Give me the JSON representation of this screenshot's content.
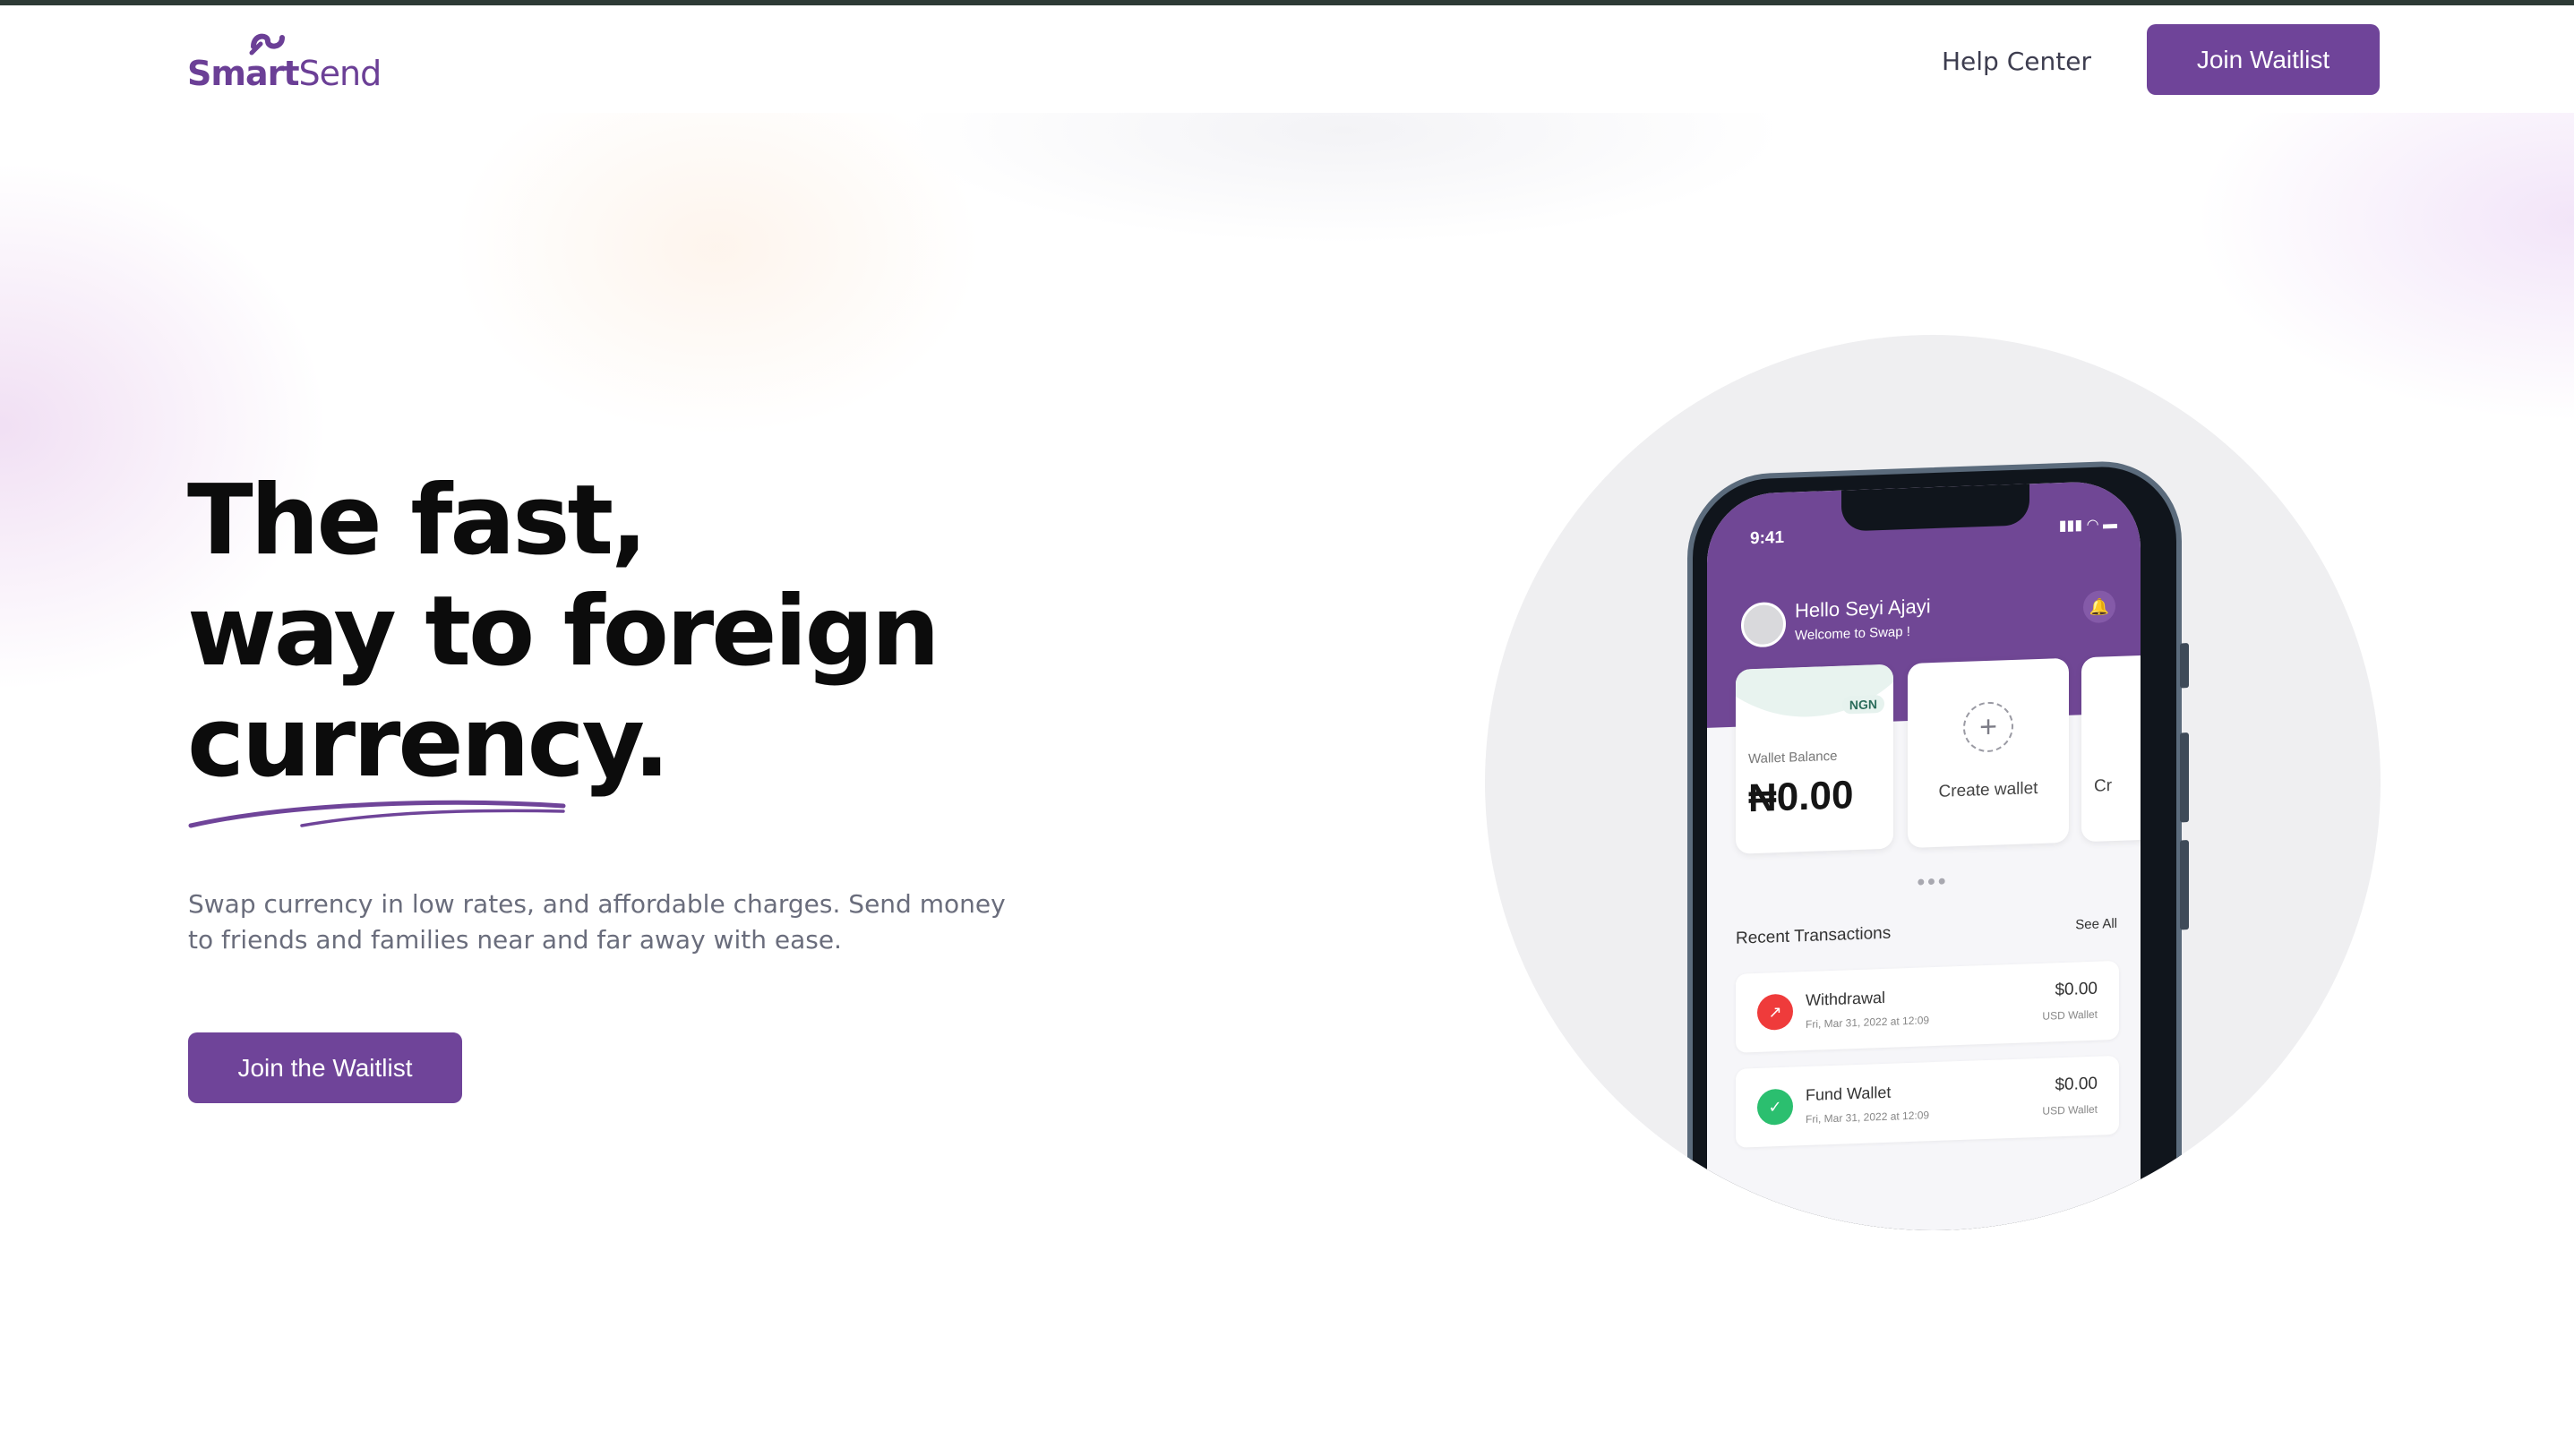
{
  "header": {
    "logo_text_bold": "Smart",
    "logo_text_light": "Send",
    "help_label": "Help Center",
    "cta_label": "Join Waitlist"
  },
  "hero": {
    "headline_line1": "The fast,",
    "headline_line2": "way to foreign",
    "headline_line3": "currency.",
    "subtitle": "Swap currency in low rates, and affordable charges. Send money to friends and families near and far away with ease.",
    "cta_label": "Join the Waitlist"
  },
  "phone": {
    "time": "9:41",
    "greeting": "Hello Seyi Ajayi",
    "welcome": "Welcome to Swap !",
    "wallet": {
      "currency_badge": "NGN",
      "label": "Wallet Balance",
      "balance": "₦0.00"
    },
    "create_wallet_label": "Create wallet",
    "third_card_partial": "Cr",
    "recent_title": "Recent Transactions",
    "see_all": "See All",
    "transactions": [
      {
        "title": "Withdrawal",
        "date": "Fri, Mar 31, 2022 at 12:09",
        "amount": "$0.00",
        "wallet": "USD Wallet",
        "icon": "arrow-up-right-icon",
        "color": "#ef3b3b"
      },
      {
        "title": "Fund Wallet",
        "date": "Fri, Mar 31, 2022 at 12:09",
        "amount": "$0.00",
        "wallet": "USD Wallet",
        "icon": "checkmark-icon",
        "color": "#2bbf6f"
      }
    ]
  },
  "colors": {
    "brand": "#6f4499",
    "headline": "#0c0c0c",
    "subtitle": "#6a6d7c"
  }
}
